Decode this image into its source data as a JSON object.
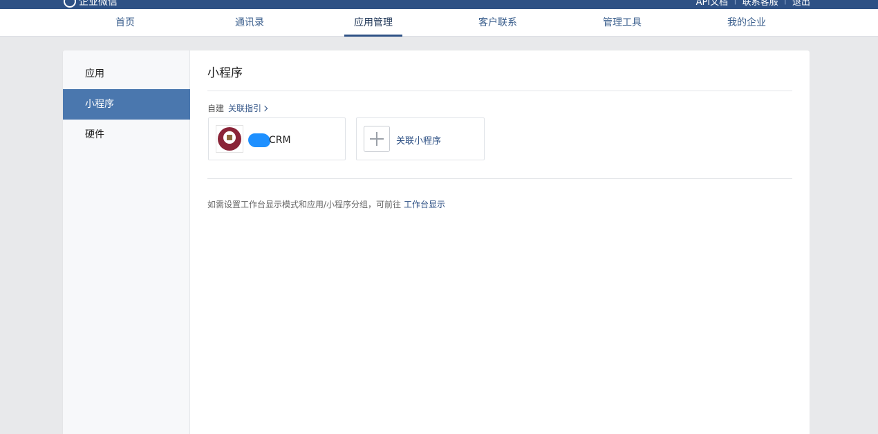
{
  "topbar": {
    "brand": "企业微信",
    "links": [
      "API文档",
      "联系客服",
      "退出"
    ]
  },
  "nav": {
    "tabs": [
      {
        "label": "首页"
      },
      {
        "label": "通讯录"
      },
      {
        "label": "应用管理"
      },
      {
        "label": "客户联系"
      },
      {
        "label": "管理工具"
      },
      {
        "label": "我的企业"
      }
    ],
    "active_index": 2
  },
  "sidebar": {
    "items": [
      {
        "label": "应用"
      },
      {
        "label": "小程序"
      },
      {
        "label": "硬件"
      }
    ],
    "active_index": 1
  },
  "main": {
    "title": "小程序",
    "self_built_label": "自建",
    "guide_link": "关联指引",
    "apps": [
      {
        "name_suffix": "CRM",
        "logo_icon": "bank-coin-logo"
      }
    ],
    "link_card_label": "关联小程序",
    "hint_text": "如需设置工作台显示模式和应用/小程序分组，可前往",
    "hint_link": "工作台显示"
  },
  "colors": {
    "header_blue": "#2e5185",
    "sidebar_active": "#4a77ae",
    "link_blue": "#2e5185",
    "redaction": "#1e90ff"
  }
}
